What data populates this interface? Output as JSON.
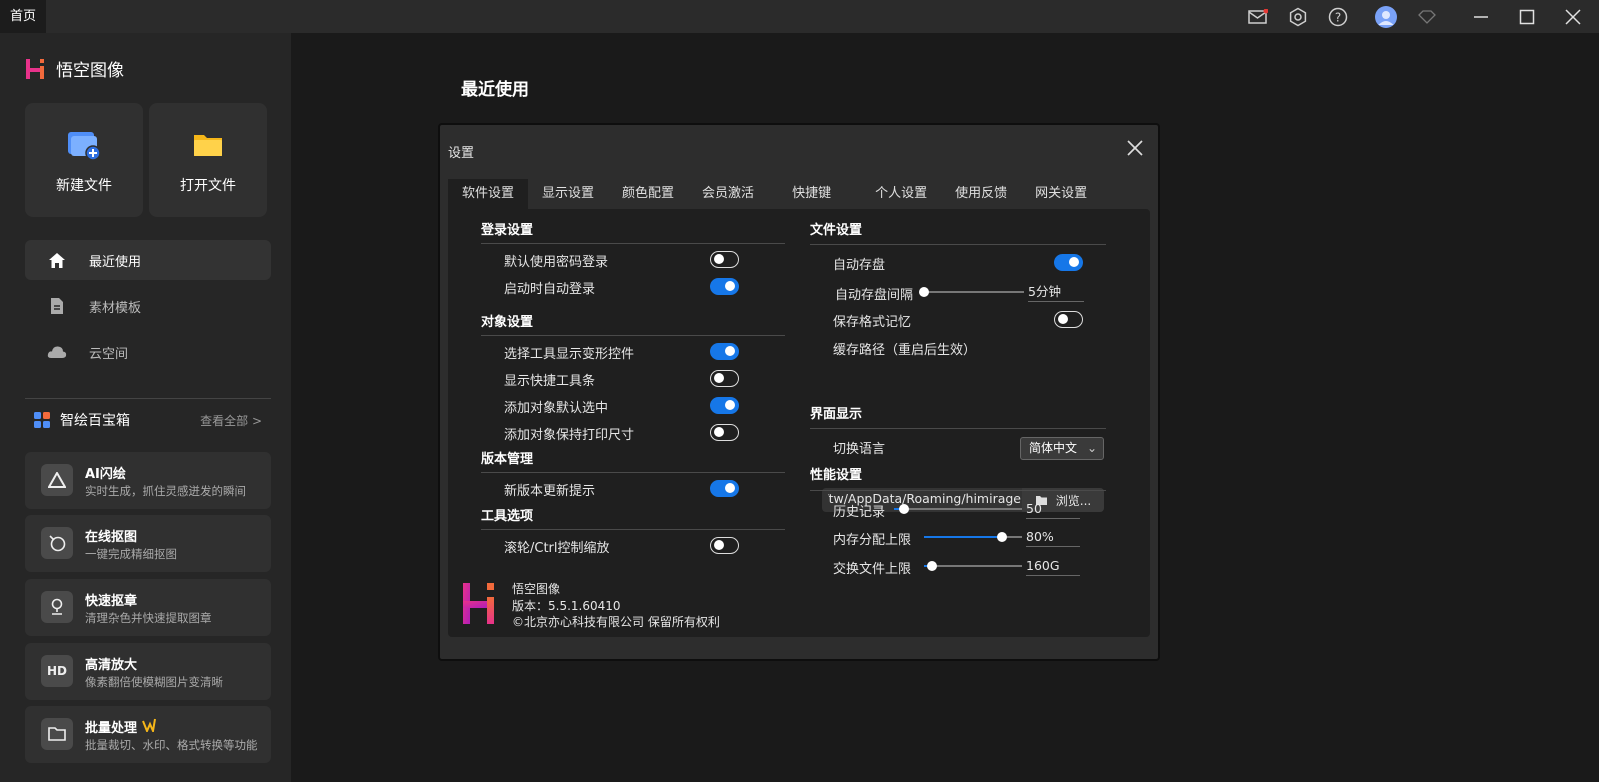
{
  "titlebar": {
    "home_tab": "首页"
  },
  "sidebar": {
    "app_name": "悟空图像",
    "new_file": "新建文件",
    "open_file": "打开文件",
    "nav": [
      {
        "label": "最近使用",
        "icon": "home-icon"
      },
      {
        "label": "素材模板",
        "icon": "document-icon"
      },
      {
        "label": "云空间",
        "icon": "cloud-icon"
      }
    ],
    "toolbox_title": "智绘百宝箱",
    "toolbox_all": "查看全部 >",
    "tools": [
      {
        "title": "AI闪绘",
        "desc": "实时生成，抓住灵感迸发的瞬间",
        "icon": "ai-draw-icon"
      },
      {
        "title": "在线抠图",
        "desc": "一键完成精细抠图",
        "icon": "cutout-icon"
      },
      {
        "title": "快速抠章",
        "desc": "清理杂色并快速提取图章",
        "icon": "stamp-icon"
      },
      {
        "title": "高清放大",
        "desc": "像素翻倍使模糊图片变清晰",
        "icon": "hd-icon",
        "badge": "HD"
      },
      {
        "title": "批量处理",
        "desc": "批量裁切、水印、格式转换等功能",
        "icon": "folder-icon"
      }
    ]
  },
  "main": {
    "title": "最近使用"
  },
  "dialog": {
    "title": "设置",
    "tabs": [
      "软件设置",
      "显示设置",
      "颜色配置",
      "会员激活",
      "快捷键",
      "个人设置",
      "使用反馈",
      "网关设置"
    ],
    "left": {
      "login_title": "登录设置",
      "login_items": [
        {
          "label": "默认使用密码登录",
          "on": false
        },
        {
          "label": "启动时自动登录",
          "on": true
        }
      ],
      "object_title": "对象设置",
      "object_items": [
        {
          "label": "选择工具显示变形控件",
          "on": true
        },
        {
          "label": "显示快捷工具条",
          "on": false
        },
        {
          "label": "添加对象默认选中",
          "on": true
        },
        {
          "label": "添加对象保持打印尺寸",
          "on": false
        }
      ],
      "version_title": "版本管理",
      "version_items": [
        {
          "label": "新版本更新提示",
          "on": true
        }
      ],
      "tool_title": "工具选项",
      "tool_items": [
        {
          "label": "滚轮/Ctrl控制缩放",
          "on": false
        }
      ]
    },
    "right": {
      "file_title": "文件设置",
      "autosave_label": "自动存盘",
      "autosave_on": true,
      "interval_label": "自动存盘间隔",
      "interval_value": "5分钟",
      "interval_level": 0.02,
      "format_memory_label": "保存格式记忆",
      "format_memory_on": false,
      "cache_label": "缓存路径（重启后生效）",
      "cache_path": "rs/tw/AppData/Roaming/himirage",
      "browse_label": "浏览...",
      "ui_title": "界面显示",
      "language_label": "切换语言",
      "language_value": "简体中文",
      "perf_title": "性能设置",
      "history_label": "历史记录",
      "history_value": "50",
      "history_level": 0.08,
      "memory_label": "内存分配上限",
      "memory_value": "80%",
      "memory_level": 0.8,
      "swap_label": "交换文件上限",
      "swap_value": "160G",
      "swap_level": 0.08
    },
    "about": {
      "name": "悟空图像",
      "version": "版本：5.5.1.60410",
      "copyright": "©北京亦心科技有限公司 保留所有权利"
    }
  },
  "colors": {
    "accent": "#1677e8",
    "brand_pink": "#e8328a",
    "brand_orange": "#f26a3c"
  }
}
